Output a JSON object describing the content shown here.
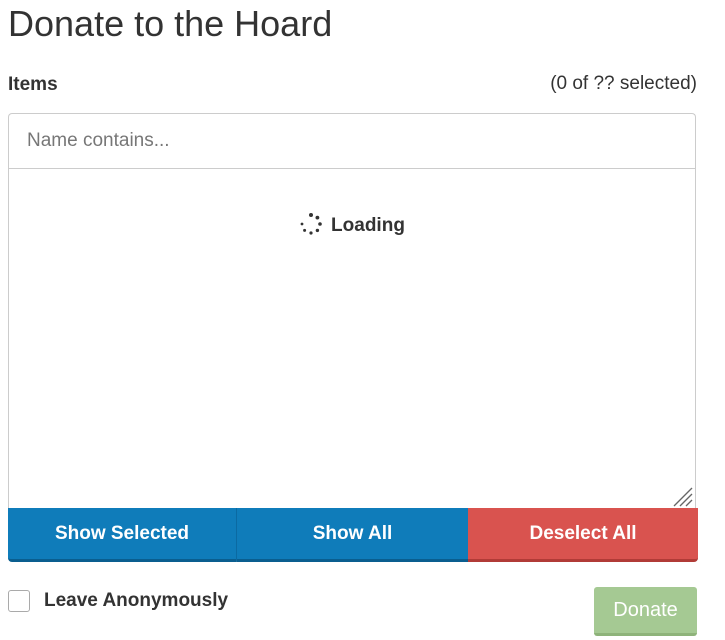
{
  "page": {
    "title": "Donate to the Hoard"
  },
  "items": {
    "label": "Items",
    "selection_count": "(0 of ?? selected)",
    "filter_placeholder": "Name contains...",
    "filter_value": "",
    "loading_text": "Loading"
  },
  "buttons": {
    "show_selected": "Show Selected",
    "show_all": "Show All",
    "deselect_all": "Deselect All",
    "donate": "Donate"
  },
  "options": {
    "anonymous_label": "Leave Anonymously",
    "anonymous_checked": false
  },
  "icons": {
    "spinner": "spinner-icon",
    "resize": "resize-handle-icon"
  },
  "colors": {
    "primary_blue": "#0f7cba",
    "danger_red": "#d9534f",
    "donate_green_disabled": "#a5c993",
    "text": "#333333",
    "border": "#cccccc"
  }
}
